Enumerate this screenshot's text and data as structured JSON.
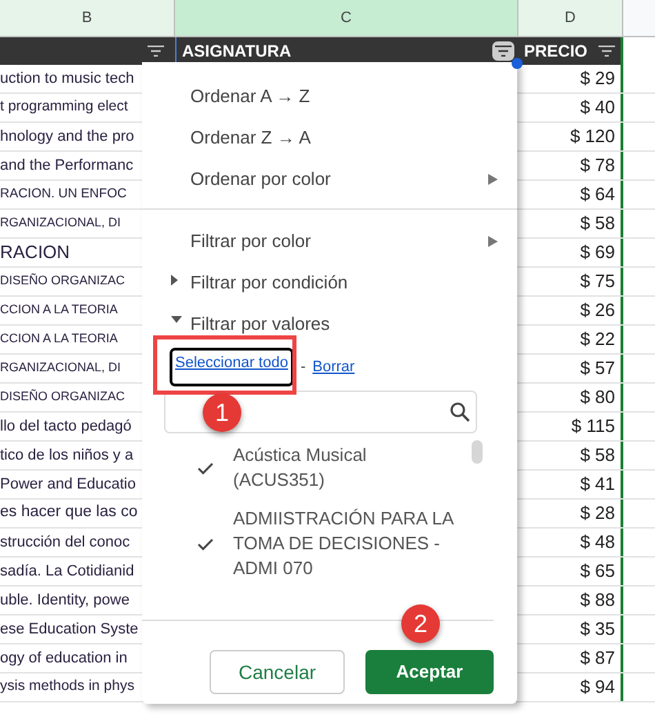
{
  "columns": [
    {
      "letter": "B",
      "selected": false
    },
    {
      "letter": "C",
      "selected": true
    },
    {
      "letter": "D",
      "selected": false
    }
  ],
  "header": {
    "asignatura": "ASIGNATURA",
    "precio": "PRECIO"
  },
  "rows": [
    {
      "column_b": "uction to music tech",
      "precio": "$ 29"
    },
    {
      "column_b": "t programming elect",
      "precio": "$ 40"
    },
    {
      "column_b": "hnology and the pro",
      "precio": "$ 120"
    },
    {
      "column_b": "and the Performanc",
      "precio": "$ 78"
    },
    {
      "column_b": "RACION. UN ENFOC",
      "precio": "$ 64"
    },
    {
      "column_b": "RGANIZACIONAL, DI",
      "precio": "$ 58"
    },
    {
      "column_b": "RACION",
      "precio": "$ 69"
    },
    {
      "column_b": "DISEÑO ORGANIZAC",
      "precio": "$ 75"
    },
    {
      "column_b": "CCION A LA TEORIA",
      "precio": "$ 26"
    },
    {
      "column_b": "CCION A LA TEORIA",
      "precio": "$ 22"
    },
    {
      "column_b": "RGANIZACIONAL, DI",
      "precio": "$ 57"
    },
    {
      "column_b": "DISEÑO ORGANIZAC",
      "precio": "$ 80"
    },
    {
      "column_b": "llo del tacto pedagó",
      "precio": "$ 115"
    },
    {
      "column_b": "tico de los niños y a",
      "precio": "$ 58"
    },
    {
      "column_b": "Power and Educatio",
      "precio": "$ 41"
    },
    {
      "column_b": "es hacer que las co",
      "precio": "$ 28"
    },
    {
      "column_b": "strucción del conoc",
      "precio": "$ 48"
    },
    {
      "column_b": "sadía. La Cotidianid",
      "precio": "$ 65"
    },
    {
      "column_b": "uble. Identity, powe",
      "precio": "$ 88"
    },
    {
      "column_b": "ese Education Syste",
      "precio": "$ 35"
    },
    {
      "column_b": "ogy of education in",
      "precio": "$ 87"
    },
    {
      "column_b": "ysis methods in phys",
      "precio": "$ 94"
    }
  ],
  "menu": {
    "sort_items": [
      {
        "label": "Ordenar A → Z",
        "kind": "plain"
      },
      {
        "label": "Ordenar Z → A",
        "kind": "plain"
      },
      {
        "label": "Ordenar por color",
        "kind": "submenu"
      }
    ],
    "filter_items": [
      {
        "label": "Filtrar por color",
        "kind": "submenu"
      },
      {
        "label": "Filtrar por condición",
        "kind": "section",
        "expanded": false
      },
      {
        "label": "Filtrar por valores",
        "kind": "section",
        "expanded": true
      }
    ],
    "select_all": "Seleccionar todo",
    "separator": "-",
    "clear": "Borrar",
    "values": [
      {
        "label": "Acústica Musical (ACUS351)",
        "checked": true
      },
      {
        "label": "ADMIISTRACIÓN PARA LA TOMA DE DECISIONES - ADMI 070",
        "checked": true
      }
    ],
    "cancel": "Cancelar",
    "accept": "Aceptar"
  },
  "annotations": [
    {
      "label": "1"
    },
    {
      "label": "2"
    }
  ]
}
